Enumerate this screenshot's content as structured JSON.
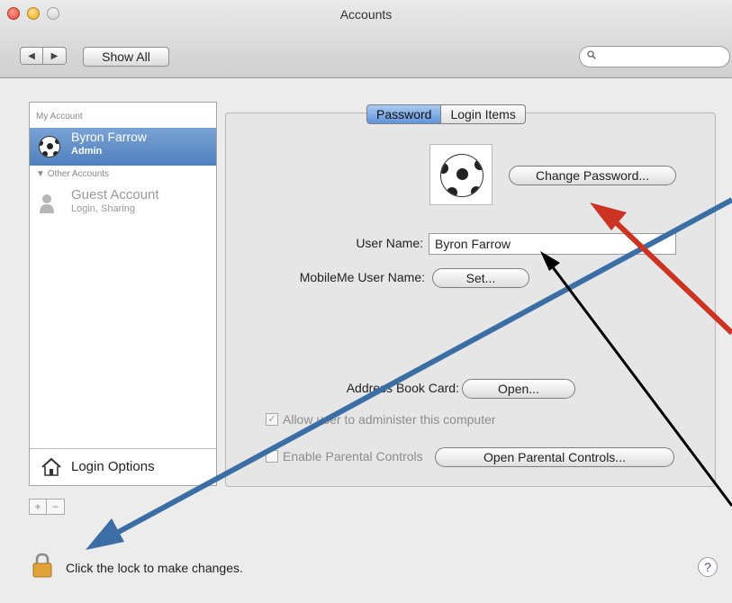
{
  "window": {
    "title": "Accounts"
  },
  "toolbar": {
    "back_icon": "triangle-left-icon",
    "forward_icon": "triangle-right-icon",
    "show_all_label": "Show All",
    "search_placeholder": "",
    "search_icon": "magnifier-icon"
  },
  "sidebar": {
    "my_account_header": "My Account",
    "current_user": {
      "name": "Byron Farrow",
      "role": "Admin",
      "icon": "soccer-ball-icon"
    },
    "other_accounts_header": "Other Accounts",
    "other_accounts": [
      {
        "name": "Guest Account",
        "detail": "Login, Sharing",
        "icon": "silhouette-icon"
      }
    ],
    "login_options_label": "Login Options",
    "add_label": "+",
    "remove_label": "−"
  },
  "tabs": [
    {
      "label": "Password",
      "selected": true
    },
    {
      "label": "Login Items",
      "selected": false
    }
  ],
  "form": {
    "change_password_label": "Change Password...",
    "user_name_label": "User Name:",
    "user_name_value": "Byron Farrow",
    "mobileme_label": "MobileMe User Name:",
    "mobileme_button": "Set...",
    "address_book_label": "Address Book Card:",
    "address_book_button": "Open...",
    "allow_admin_label": "Allow user to administer this computer",
    "allow_admin_checked": true,
    "parental_label": "Enable Parental Controls",
    "parental_checked": false,
    "parental_button": "Open Parental Controls..."
  },
  "footer": {
    "lock_text": "Click the lock to make changes.",
    "help_label": "?",
    "lock_icon": "padlock-icon"
  },
  "annotations": {
    "colors": {
      "blue": "#3a6ea5",
      "red": "#cc3322",
      "black": "#000000"
    }
  }
}
